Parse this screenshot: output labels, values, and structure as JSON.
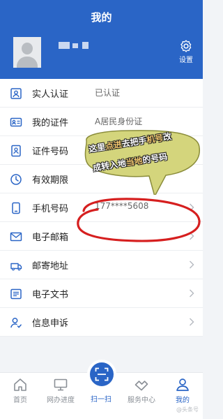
{
  "header": {
    "title": "我的",
    "settings_label": "设置"
  },
  "rows": [
    {
      "label": "实人认证",
      "value": "已认证",
      "icon": "id-card-icon"
    },
    {
      "label": "我的证件",
      "value": "A居民身份证",
      "icon": "card-icon"
    },
    {
      "label": "证件号码",
      "value": "",
      "icon": "id-number-icon"
    },
    {
      "label": "有效期限",
      "value": "",
      "icon": "clock-icon"
    },
    {
      "label": "手机号码",
      "value": "177****5608",
      "icon": "phone-icon"
    },
    {
      "label": "电子邮箱",
      "value": "",
      "icon": "mail-icon"
    },
    {
      "label": "邮寄地址",
      "value": "",
      "icon": "address-icon"
    },
    {
      "label": "电子文书",
      "value": "",
      "icon": "document-icon"
    },
    {
      "label": "信息申诉",
      "value": "",
      "icon": "appeal-icon"
    }
  ],
  "annotation": {
    "line1_a": "这里",
    "line1_b": "点进",
    "line1_c": "去把手",
    "line1_d": "机号",
    "line1_e": "改",
    "line2_a": "成转入地",
    "line2_b": "当地",
    "line2_c": "的号码"
  },
  "tabs": [
    {
      "label": "首页",
      "icon": "home-icon"
    },
    {
      "label": "网办进度",
      "icon": "monitor-icon"
    },
    {
      "label": "扫一扫",
      "icon": "scan-icon"
    },
    {
      "label": "服务中心",
      "icon": "service-icon"
    },
    {
      "label": "我的",
      "icon": "person-icon"
    }
  ],
  "colors": {
    "brand": "#2a65c6",
    "highlight": "#f5c86e",
    "circle": "#d61f1f"
  },
  "watermark": "@头条号"
}
